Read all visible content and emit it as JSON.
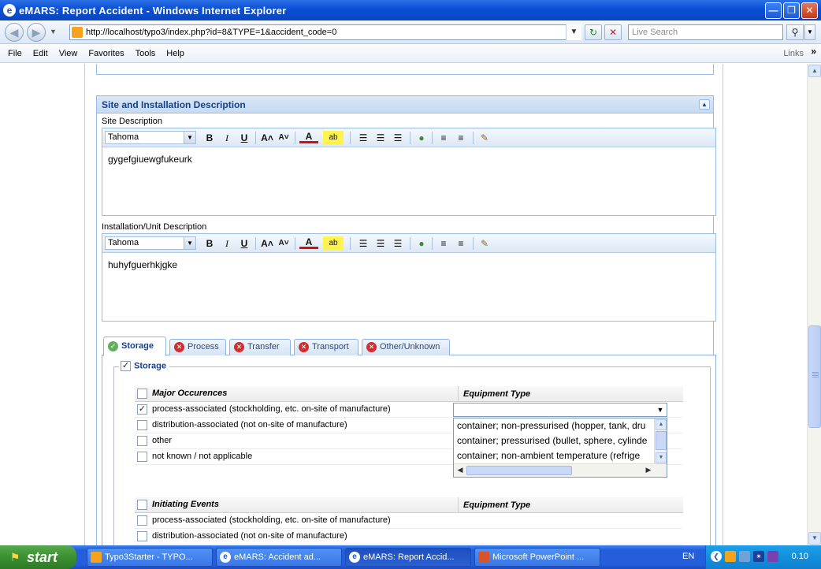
{
  "window": {
    "title": "eMARS: Report Accident - Windows Internet Explorer",
    "icon": "ie-icon"
  },
  "address_bar": {
    "url": "http://localhost/typo3/index.php?id=8&TYPE=1&accident_code=0",
    "search_placeholder": "Live Search"
  },
  "menu": {
    "items": [
      "File",
      "Edit",
      "View",
      "Favorites",
      "Tools",
      "Help"
    ],
    "links_label": "Links",
    "links_chevron": "»"
  },
  "panel": {
    "title": "Site and Installation Description",
    "site_description": {
      "label": "Site Description",
      "font": "Tahoma",
      "text": "gygefgiuewgfukeurk"
    },
    "installation_description": {
      "label": "Installation/Unit Description",
      "font": "Tahoma",
      "text": "huhyfguerhkjgke"
    },
    "toolbar": {
      "bold": "B",
      "italic": "I",
      "underline": "U",
      "grow": "A˄",
      "shrink": "A˅",
      "font_color": "A",
      "highlight": "ab"
    }
  },
  "tabs": [
    {
      "label": "Storage",
      "status": "ok",
      "active": true
    },
    {
      "label": "Process",
      "status": "error",
      "active": false
    },
    {
      "label": "Transfer",
      "status": "error",
      "active": false
    },
    {
      "label": "Transport",
      "status": "error",
      "active": false
    },
    {
      "label": "Other/Unknown",
      "status": "error",
      "active": false
    }
  ],
  "storage": {
    "legend": "Storage",
    "checked": true,
    "major_grid": {
      "header_col1": "Major Occurences",
      "header_col2": "Equipment Type",
      "rows": [
        {
          "text": "process-associated (stockholding, etc. on-site of manufacture)",
          "checked": true
        },
        {
          "text": "distribution-associated (not on-site of manufacture)",
          "checked": false
        },
        {
          "text": "other",
          "checked": false
        },
        {
          "text": "not known / not applicable",
          "checked": false
        }
      ]
    },
    "equipment_dropdown": {
      "value": "",
      "options": [
        "container; non-pressurised (hopper, tank, dru",
        "container; pressurised (bullet, sphere, cylinde",
        "container; non-ambient temperature (refrige"
      ]
    },
    "initiating_grid": {
      "header_col1": "Initiating Events",
      "header_col2": "Equipment Type",
      "rows": [
        {
          "text": "process-associated (stockholding, etc. on-site of manufacture)",
          "checked": false
        },
        {
          "text": "distribution-associated (not on-site of manufacture)",
          "checked": false
        }
      ]
    }
  },
  "taskbar": {
    "start_label": "start",
    "buttons": [
      {
        "label": "Typo3Starter - TYPO...",
        "icon": "typo3-icon",
        "active": false
      },
      {
        "label": "eMARS: Accident ad...",
        "icon": "ie-icon",
        "active": false
      },
      {
        "label": "eMARS: Report Accid...",
        "icon": "ie-icon",
        "active": true
      },
      {
        "label": "Microsoft PowerPoint ...",
        "icon": "powerpoint-icon",
        "active": false
      }
    ],
    "language": "EN",
    "clock": "0.10"
  }
}
